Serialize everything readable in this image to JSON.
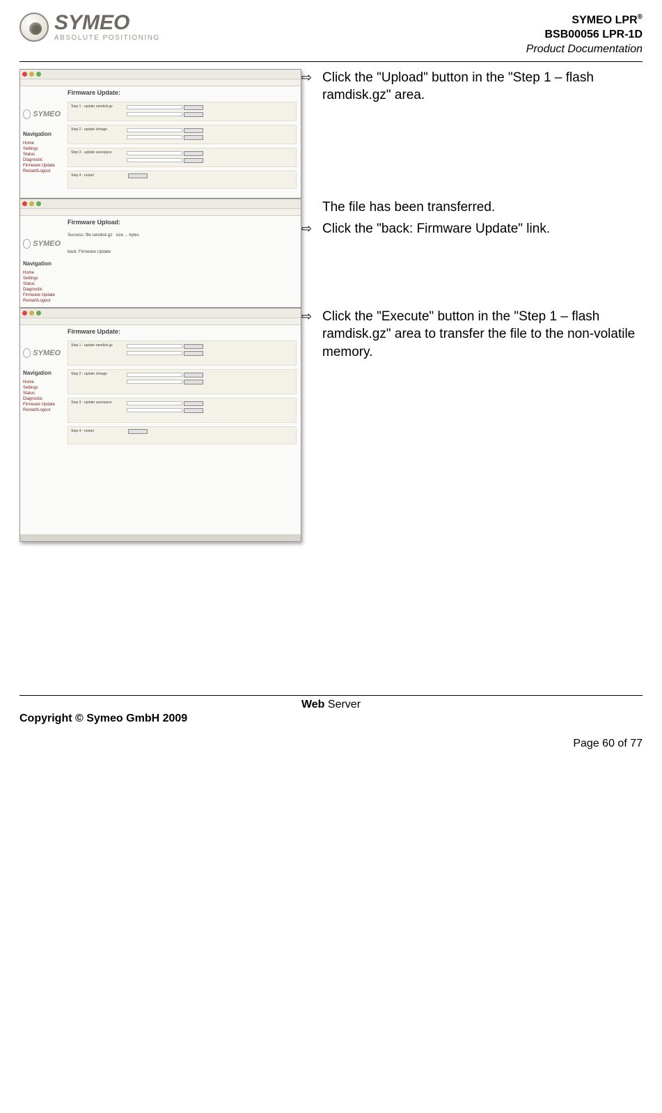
{
  "header": {
    "brand": "SYMEO",
    "tagline": "ABSOLUTE POSITIONING",
    "title_line1_prefix": "SYMEO LPR",
    "title_line1_sup": "®",
    "title_line2": "BSB00056 LPR-1D",
    "title_line3": "Product Documentation"
  },
  "mock_nav": {
    "heading": "Navigation",
    "items": [
      "Home",
      "Settings",
      "Status",
      "Diagnostic",
      "Firmware Update",
      "Restart/Logout"
    ]
  },
  "mock_pages": {
    "update_title": "Firmware Update:",
    "upload_title": "Firmware Upload:",
    "step1": "Step 1 - update ramdisk.gz",
    "step2": "Step 2 - update zImage",
    "step3": "Step 3 - update userspace",
    "step4": "Step 4 - restart"
  },
  "steps": [
    {
      "image_kind": "update",
      "lines": [
        {
          "type": "arrow",
          "text": "Click the \"Upload\" button in the \"Step 1 – flash ramdisk.gz\" area."
        }
      ]
    },
    {
      "image_kind": "upload",
      "lines": [
        {
          "type": "plain",
          "text": "The file has been transferred."
        },
        {
          "type": "arrow",
          "text": "Click the \"back: Firmware Update\" link."
        }
      ]
    },
    {
      "image_kind": "update_tall",
      "lines": [
        {
          "type": "arrow",
          "text": "Click the \"Execute\" button in the \"Step 1 – flash ramdisk.gz\" area to transfer the file to the non-volatile memory."
        }
      ]
    }
  ],
  "footer": {
    "section_bold": "Web",
    "section_rest": " Server",
    "copyright": "Copyright © Symeo GmbH 2009",
    "page": "Page 60 of 77"
  },
  "glyphs": {
    "arrow": "⇨"
  }
}
